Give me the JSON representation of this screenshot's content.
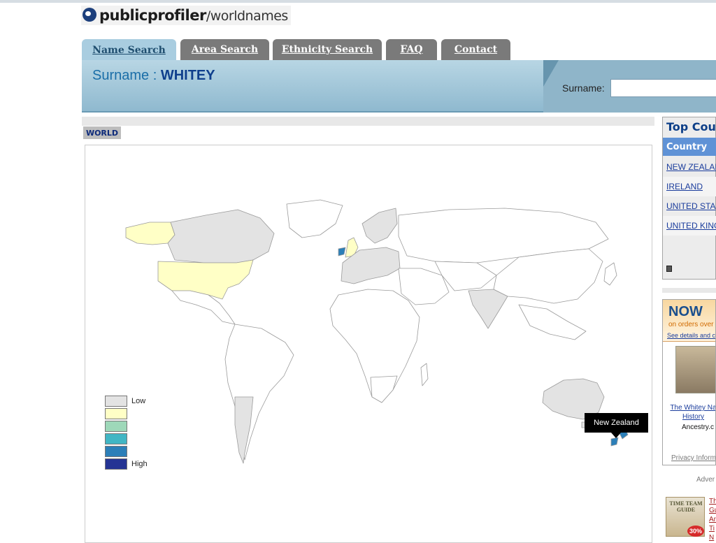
{
  "logo": {
    "brand": "publicprofiler",
    "section": "/worldnames"
  },
  "tabs": [
    {
      "label": "Name Search",
      "active": true
    },
    {
      "label": "Area Search",
      "active": false
    },
    {
      "label": "Ethnicity Search",
      "active": false
    },
    {
      "label": "FAQ",
      "active": false
    },
    {
      "label": "Contact",
      "active": false
    }
  ],
  "header": {
    "title_prefix": "Surname : ",
    "surname": "WHITEY",
    "search_label": "Surname:",
    "search_value": ""
  },
  "map": {
    "region_tag": "WORLD",
    "tooltip": "New Zealand",
    "legend": [
      {
        "label": "Low",
        "color": "#e3e3e3"
      },
      {
        "label": "",
        "color": "#ffffc6"
      },
      {
        "label": "",
        "color": "#9ed8b9"
      },
      {
        "label": "",
        "color": "#41b6c4"
      },
      {
        "label": "",
        "color": "#2c7fb8"
      },
      {
        "label": "High",
        "color": "#253494"
      }
    ],
    "default_fill": "#ffffff"
  },
  "top_countries": {
    "title": "Top Cou",
    "column_header": "Country",
    "rows": [
      "NEW ZEALAN",
      "IRELAND",
      "UNITED STA",
      "UNITED KING"
    ]
  },
  "ad": {
    "headline": "NOW",
    "subline": "on orders over",
    "details_link": "See details and c",
    "product_link_line1": "The Whitey Na",
    "product_link_line2": "History",
    "source": "Ancestry.c",
    "privacy": "Privacy Inform",
    "advert_label": "Adver"
  },
  "book": {
    "title": "TIME TEAM GUIDE",
    "badge": "30%",
    "links": [
      "Th",
      "Gu",
      "An",
      "Ti",
      "N"
    ]
  }
}
